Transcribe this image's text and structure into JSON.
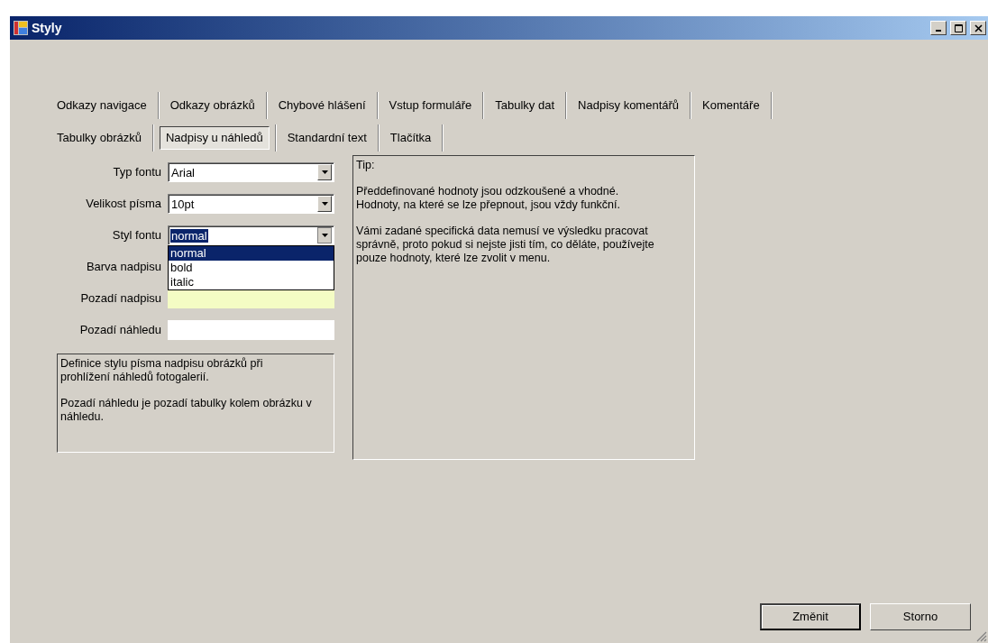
{
  "window": {
    "title": "Styly"
  },
  "tab_rows": [
    [
      {
        "label": "Odkazy navigace",
        "selected": false
      },
      {
        "label": "Odkazy obrázků",
        "selected": false
      },
      {
        "label": "Chybové hlášení",
        "selected": false
      },
      {
        "label": "Vstup formuláře",
        "selected": false
      },
      {
        "label": "Tabulky dat",
        "selected": false
      },
      {
        "label": "Nadpisy komentářů",
        "selected": false
      },
      {
        "label": "Komentáře",
        "selected": false
      }
    ],
    [
      {
        "label": "Tabulky obrázků",
        "selected": false
      },
      {
        "label": "Nadpisy u náhledů",
        "selected": true
      },
      {
        "label": "Standardní text",
        "selected": false
      },
      {
        "label": "Tlačítka",
        "selected": false
      }
    ]
  ],
  "fields": [
    {
      "kind": "select",
      "label": "Typ fontu",
      "value": "Arial",
      "focused": false,
      "expanded": false
    },
    {
      "kind": "select",
      "label": "Velikost písma",
      "value": "10pt",
      "focused": false,
      "expanded": false
    },
    {
      "kind": "select",
      "label": "Styl fontu",
      "value": "normal",
      "focused": true,
      "expanded": true,
      "options": [
        {
          "label": "normal",
          "selected": true
        },
        {
          "label": "bold",
          "selected": false
        },
        {
          "label": "italic",
          "selected": false
        }
      ]
    },
    {
      "kind": "color",
      "label": "Barva nadpisu"
    },
    {
      "kind": "color",
      "label": "Pozadí nadpisu",
      "color": "#f4fcc4"
    },
    {
      "kind": "color",
      "label": "Pozadí náhledu",
      "color": "#ffffff"
    }
  ],
  "description": [
    "Definice stylu písma nadpisu obrázků při prohlížení náhledů fotogalerií.",
    "Pozadí náhledu je pozadí tabulky kolem obrázku v náhledu."
  ],
  "tip": [
    "Tip:",
    "Předdefinované hodnoty jsou odzkoušené a vhodné. Hodnoty, na které se lze přepnout, jsou vždy funkční.",
    "Vámi zadané specifická data nemusí ve výsledku pracovat správně, proto pokud si nejste jisti tím, co děláte, používejte pouze hodnoty, které lze zvolit v menu."
  ],
  "buttons": [
    "Změnit",
    "Storno"
  ]
}
